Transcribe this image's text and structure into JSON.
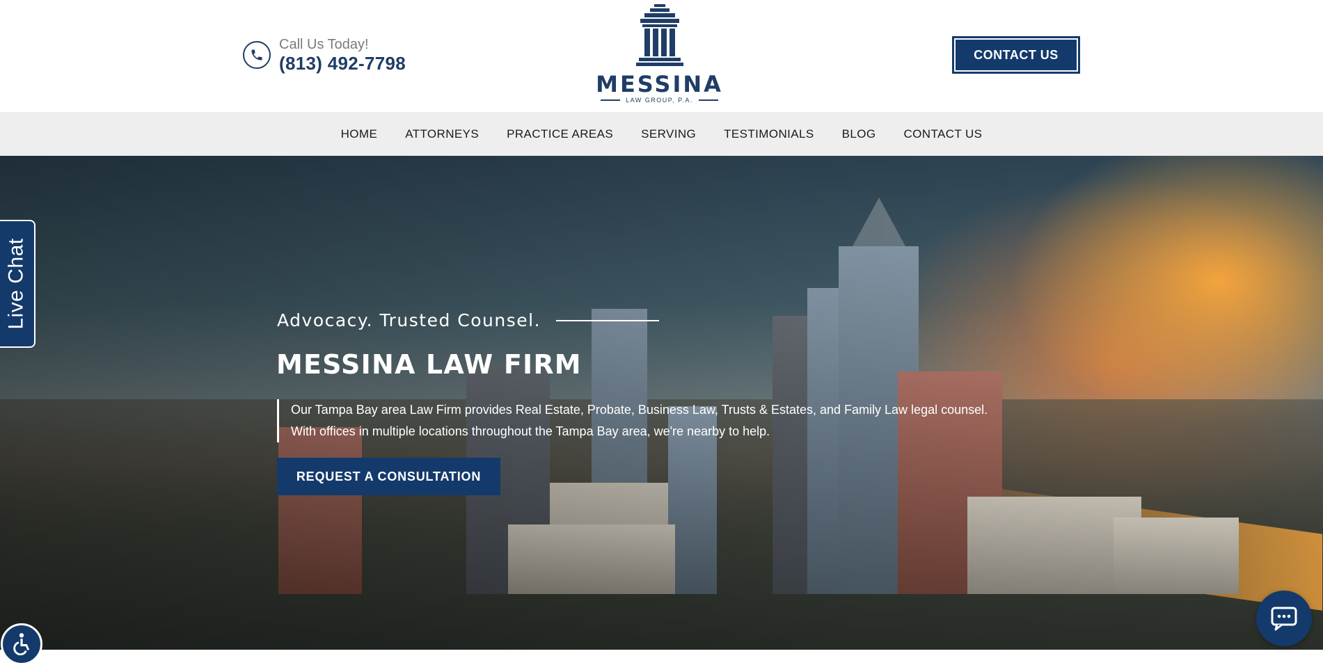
{
  "header": {
    "call_label": "Call Us Today!",
    "phone": "(813) 492-7798",
    "logo_name": "MESSINA",
    "logo_sub": "LAW GROUP, P.A.",
    "contact_button": "CONTACT US"
  },
  "nav": {
    "items": [
      {
        "label": "HOME"
      },
      {
        "label": "ATTORNEYS"
      },
      {
        "label": "PRACTICE AREAS"
      },
      {
        "label": "SERVING"
      },
      {
        "label": "TESTIMONIALS"
      },
      {
        "label": "BLOG"
      },
      {
        "label": "CONTACT US"
      }
    ]
  },
  "hero": {
    "tagline": "Advocacy. Trusted Counsel.",
    "title": "MESSINA LAW FIRM",
    "desc_line1": "Our Tampa Bay area Law Firm provides Real Estate, Probate, Business Law, Trusts & Estates, and Family Law legal counsel.",
    "desc_line2": "With offices in multiple locations throughout the Tampa Bay area, we're nearby to help.",
    "cta": "REQUEST A CONSULTATION"
  },
  "widgets": {
    "live_chat": "Live Chat"
  },
  "colors": {
    "brand": "#133a6b",
    "nav_bg": "#eeeeee"
  }
}
